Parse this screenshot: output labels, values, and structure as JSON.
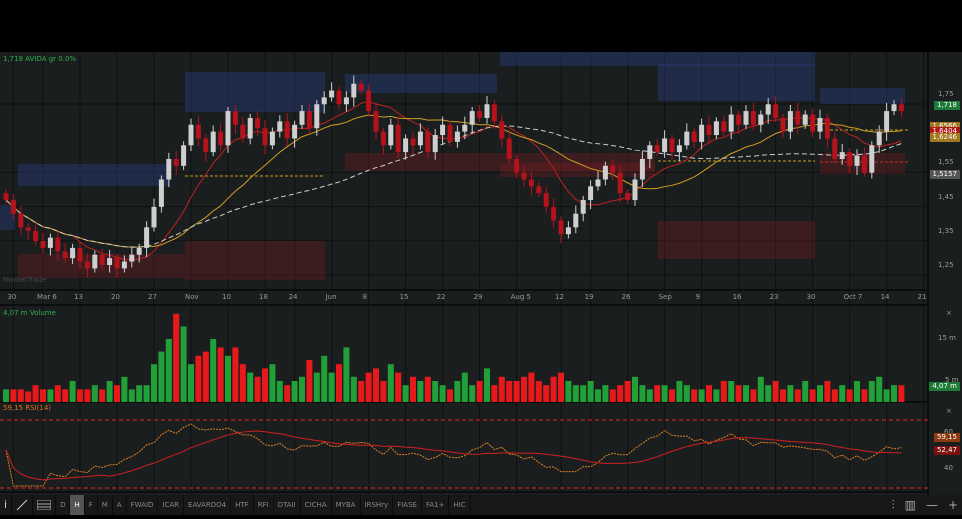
{
  "header": {
    "symbol_label": "1,718 AVIDA gr 0.0%"
  },
  "price_axis": {
    "ticks": [
      {
        "v": 1.75,
        "t": "1,75"
      },
      {
        "v": 1.55,
        "t": "1,55"
      },
      {
        "v": 1.45,
        "t": "1,45"
      },
      {
        "v": 1.35,
        "t": "1,35"
      },
      {
        "v": 1.25,
        "t": "1,25"
      }
    ],
    "tags": [
      {
        "v": 1.718,
        "t": "1,718",
        "c": "#1e7a36"
      },
      {
        "v": 1.6566,
        "t": "1,6566",
        "c": "#a07820"
      },
      {
        "v": 1.6404,
        "t": "1,6404",
        "c": "#b01818"
      },
      {
        "v": 1.6246,
        "t": "1,6246",
        "c": "#a07820"
      },
      {
        "v": 1.5157,
        "t": "1,5157",
        "c": "#555555"
      }
    ]
  },
  "watermark": "MarketTrade",
  "date_axis": [
    {
      "i": 1,
      "t": "30"
    },
    {
      "i": 5,
      "t": "Mar 6"
    },
    {
      "i": 10,
      "t": "13"
    },
    {
      "i": 15,
      "t": "20"
    },
    {
      "i": 20,
      "t": "27"
    },
    {
      "i": 25,
      "t": "Nov"
    },
    {
      "i": 30,
      "t": "10"
    },
    {
      "i": 35,
      "t": "18"
    },
    {
      "i": 39,
      "t": "24"
    },
    {
      "i": 44,
      "t": "Jun"
    },
    {
      "i": 49,
      "t": "8"
    },
    {
      "i": 54,
      "t": "15"
    },
    {
      "i": 59,
      "t": "22"
    },
    {
      "i": 64,
      "t": "29"
    },
    {
      "i": 69,
      "t": "Aug 5"
    },
    {
      "i": 75,
      "t": "12"
    },
    {
      "i": 79,
      "t": "19"
    },
    {
      "i": 84,
      "t": "26"
    },
    {
      "i": 89,
      "t": "Sep"
    },
    {
      "i": 94,
      "t": "9"
    },
    {
      "i": 99,
      "t": "16"
    },
    {
      "i": 104,
      "t": "23"
    },
    {
      "i": 109,
      "t": "30"
    },
    {
      "i": 114,
      "t": "Oct 7"
    },
    {
      "i": 119,
      "t": "14"
    },
    {
      "i": 124,
      "t": "21"
    }
  ],
  "volume": {
    "label": "4,07 m Volume",
    "ticks": [
      "15 m",
      "5 m"
    ],
    "tag": "4,07 m",
    "close_icon": "×"
  },
  "rsi": {
    "label": "59,15 RSI(14)",
    "ticks": [
      "60",
      "40"
    ],
    "tags": [
      "59,15",
      "52,47"
    ],
    "close_icon": "×"
  },
  "colors": {
    "up": "#21a038",
    "down": "#e8191b",
    "bull_candle": "#cfcfcf",
    "bear_candle": "#b5121b"
  },
  "chart_data": {
    "type": "candlestick",
    "closes": [
      1.44,
      1.4,
      1.36,
      1.35,
      1.32,
      1.3,
      1.33,
      1.29,
      1.27,
      1.3,
      1.26,
      1.24,
      1.28,
      1.25,
      1.27,
      1.24,
      1.26,
      1.28,
      1.3,
      1.36,
      1.42,
      1.5,
      1.56,
      1.54,
      1.6,
      1.66,
      1.62,
      1.58,
      1.64,
      1.6,
      1.7,
      1.66,
      1.62,
      1.68,
      1.65,
      1.6,
      1.64,
      1.67,
      1.62,
      1.66,
      1.7,
      1.65,
      1.72,
      1.74,
      1.76,
      1.72,
      1.74,
      1.78,
      1.76,
      1.7,
      1.64,
      1.6,
      1.66,
      1.58,
      1.62,
      1.6,
      1.64,
      1.58,
      1.63,
      1.66,
      1.61,
      1.64,
      1.66,
      1.7,
      1.68,
      1.72,
      1.67,
      1.62,
      1.56,
      1.52,
      1.5,
      1.48,
      1.46,
      1.42,
      1.38,
      1.34,
      1.36,
      1.4,
      1.44,
      1.48,
      1.5,
      1.54,
      1.52,
      1.46,
      1.44,
      1.5,
      1.56,
      1.6,
      1.58,
      1.62,
      1.58,
      1.6,
      1.64,
      1.61,
      1.66,
      1.63,
      1.67,
      1.64,
      1.69,
      1.66,
      1.7,
      1.66,
      1.69,
      1.72,
      1.68,
      1.64,
      1.7,
      1.66,
      1.69,
      1.64,
      1.68,
      1.62,
      1.56,
      1.58,
      1.54,
      1.57,
      1.52,
      1.6,
      1.64,
      1.7,
      1.72,
      1.7
    ],
    "volumes_m": [
      3,
      3,
      3,
      2.5,
      4,
      3,
      3,
      4,
      3,
      5,
      3,
      3,
      4,
      3,
      5,
      4,
      6,
      3,
      4,
      4,
      9,
      12,
      15,
      21,
      18,
      9,
      11,
      12,
      15,
      13,
      11,
      13,
      9,
      7,
      6,
      8,
      9,
      5,
      4,
      5,
      6,
      10,
      7,
      11,
      7,
      9,
      13,
      6,
      5,
      7,
      8,
      5,
      9,
      7,
      4,
      6,
      5,
      6,
      5,
      4,
      3,
      5,
      7,
      4,
      5,
      8,
      4,
      6,
      5,
      5,
      6,
      7,
      5,
      4,
      6,
      7,
      5,
      4,
      4,
      5,
      3,
      4,
      3,
      4,
      5,
      6,
      4,
      3,
      4,
      4,
      3,
      5,
      4,
      3,
      3,
      4,
      3,
      5,
      5,
      4,
      4,
      3,
      6,
      4,
      5,
      3,
      4,
      3,
      5,
      3,
      4,
      5,
      3,
      4,
      3,
      5,
      3,
      5,
      6,
      3,
      4,
      4
    ]
  },
  "toolbar": {
    "items": [
      "D",
      "H",
      "F",
      "M",
      "A",
      "FWAID",
      "ICAR",
      "EAVARDO4",
      "HTF",
      "RFI",
      "DTAII",
      "CICHA",
      "MYBA",
      "IRSHry",
      "FIASE",
      "FA1+",
      "HIC"
    ],
    "active": "H",
    "info_icon": "i",
    "right": [
      "⫶",
      "▥",
      "—",
      "+"
    ]
  }
}
